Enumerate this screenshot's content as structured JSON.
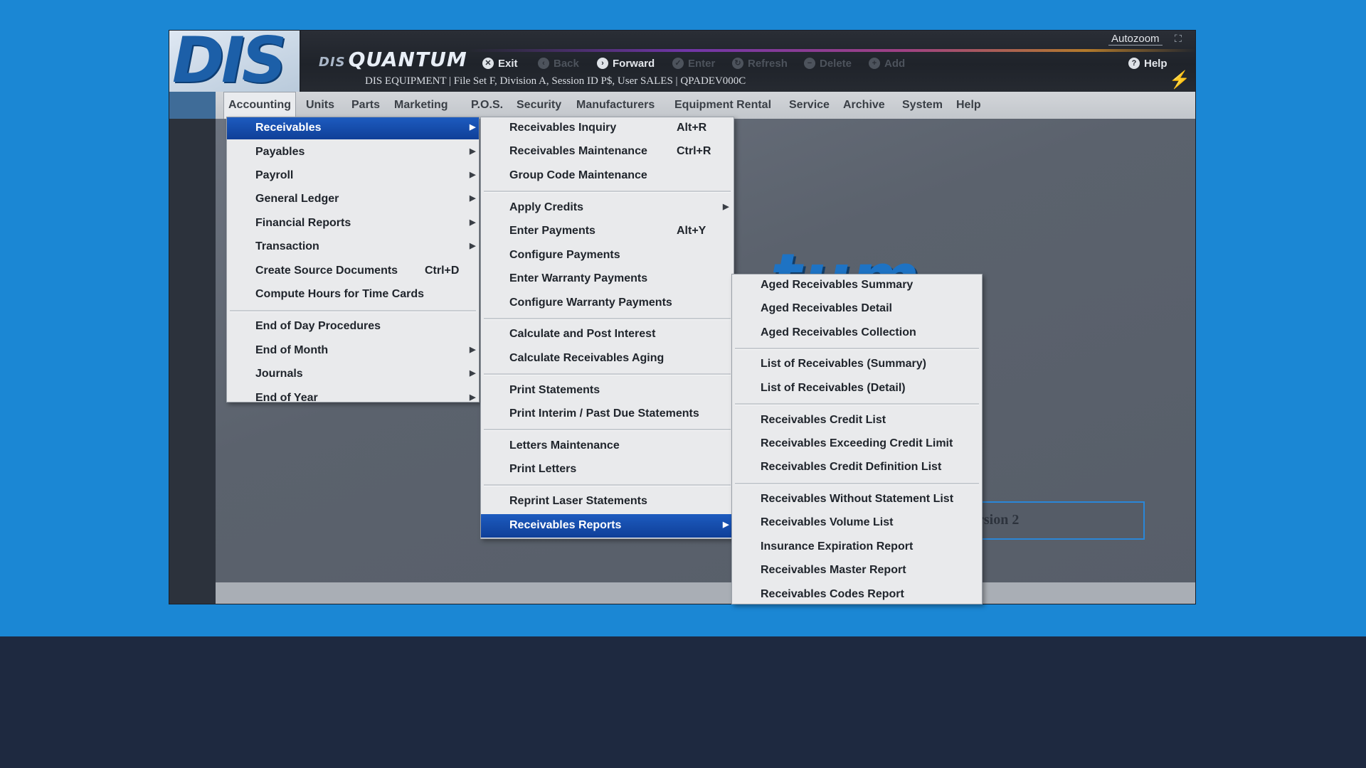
{
  "header": {
    "brand_prefix": "DIS",
    "brand": "QUANTUM",
    "logo": "DIS",
    "session_info": "DIS EQUIPMENT | File Set F, Division A, Session ID P$, User SALES | QPADEV000C",
    "autozoom": "Autozoom",
    "toolbar": [
      {
        "label": "Exit",
        "icon": "close-circle-icon",
        "enabled": true
      },
      {
        "label": "Back",
        "icon": "back-circle-icon",
        "enabled": false
      },
      {
        "label": "Forward",
        "icon": "forward-circle-icon",
        "enabled": true
      },
      {
        "label": "Enter",
        "icon": "check-circle-icon",
        "enabled": false
      },
      {
        "label": "Refresh",
        "icon": "refresh-circle-icon",
        "enabled": false
      },
      {
        "label": "Delete",
        "icon": "minus-circle-icon",
        "enabled": false
      },
      {
        "label": "Add",
        "icon": "plus-circle-icon",
        "enabled": false
      }
    ],
    "help": "Help"
  },
  "menubar": {
    "items": [
      "Accounting",
      "Units",
      "Parts",
      "Marketing",
      "P.O.S.",
      "Security",
      "Manufacturers",
      "Equipment Rental",
      "Service",
      "Archive",
      "System",
      "Help"
    ],
    "active": "Accounting"
  },
  "accounting_menu": {
    "items": [
      {
        "label": "Receivables",
        "submenu": true,
        "selected": true
      },
      {
        "label": "Payables",
        "submenu": true
      },
      {
        "label": "Payroll",
        "submenu": true
      },
      {
        "label": "General Ledger",
        "submenu": true
      },
      {
        "label": "Financial Reports",
        "submenu": true
      },
      {
        "label": "Transaction",
        "submenu": true
      },
      {
        "label": "Create Source Documents",
        "shortcut": "Ctrl+D"
      },
      {
        "label": "Compute Hours for Time Cards"
      },
      {
        "separator": true
      },
      {
        "label": "End of Day Procedures"
      },
      {
        "label": "End of Month",
        "submenu": true
      },
      {
        "label": "Journals",
        "submenu": true
      },
      {
        "label": "End of Year",
        "submenu": true
      }
    ]
  },
  "receivables_menu": {
    "items": [
      {
        "label": "Receivables Inquiry",
        "shortcut": "Alt+R"
      },
      {
        "label": "Receivables Maintenance",
        "shortcut": "Ctrl+R"
      },
      {
        "label": "Group Code Maintenance"
      },
      {
        "separator": true
      },
      {
        "label": "Apply Credits",
        "submenu": true
      },
      {
        "label": "Enter Payments",
        "shortcut": "Alt+Y"
      },
      {
        "label": "Configure Payments"
      },
      {
        "label": "Enter Warranty Payments"
      },
      {
        "label": "Configure Warranty Payments"
      },
      {
        "separator": true
      },
      {
        "label": "Calculate and Post Interest"
      },
      {
        "label": "Calculate Receivables Aging"
      },
      {
        "separator": true
      },
      {
        "label": "Print Statements"
      },
      {
        "label": "Print Interim / Past Due Statements"
      },
      {
        "separator": true
      },
      {
        "label": "Letters Maintenance"
      },
      {
        "label": "Print Letters"
      },
      {
        "separator": true
      },
      {
        "label": "Reprint Laser Statements"
      },
      {
        "label": "Receivables Reports",
        "submenu": true,
        "selected": true
      }
    ]
  },
  "reports_menu": {
    "items": [
      {
        "label": "Aged Receivables Summary"
      },
      {
        "label": "Aged Receivables Detail"
      },
      {
        "label": "Aged Receivables Collection"
      },
      {
        "separator": true
      },
      {
        "label": "List of Receivables (Summary)"
      },
      {
        "label": "List of Receivables (Detail)"
      },
      {
        "separator": true
      },
      {
        "label": "Receivables Credit List"
      },
      {
        "label": "Receivables Exceeding Credit Limit"
      },
      {
        "label": "Receivables Credit Definition List"
      },
      {
        "separator": true
      },
      {
        "label": "Receivables Without Statement List"
      },
      {
        "label": "Receivables Volume List"
      },
      {
        "label": "Insurance Expiration Report"
      },
      {
        "label": "Receivables Master Report"
      },
      {
        "label": "Receivables Codes Report"
      }
    ]
  },
  "workspace": {
    "watermark": "tum",
    "version_text": "rsion 2"
  },
  "colors": {
    "background": "#1b87d4",
    "selection": "#0f3f98",
    "brand_blue": "#1e73c4"
  }
}
